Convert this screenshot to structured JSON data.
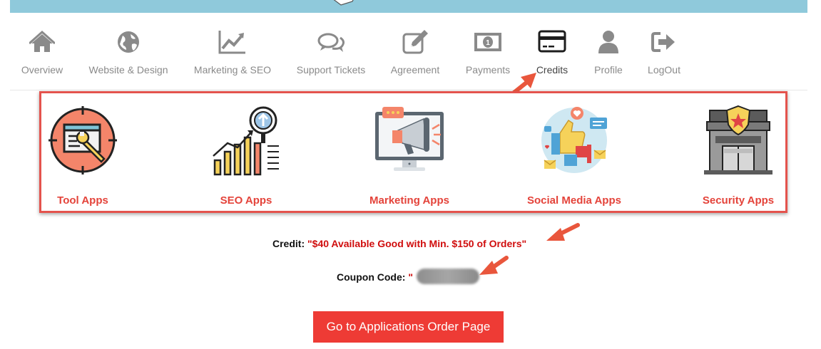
{
  "nav": {
    "items": [
      {
        "label": "Overview",
        "icon": "home-icon"
      },
      {
        "label": "Website & Design",
        "icon": "globe-icon"
      },
      {
        "label": "Marketing & SEO",
        "icon": "line-chart-icon"
      },
      {
        "label": "Support Tickets",
        "icon": "chat-bubbles-icon"
      },
      {
        "label": "Agreement",
        "icon": "edit-document-icon"
      },
      {
        "label": "Payments",
        "icon": "banknote-icon"
      },
      {
        "label": "Credits",
        "icon": "credit-card-icon",
        "active": true
      },
      {
        "label": "Profile",
        "icon": "user-icon"
      },
      {
        "label": "LogOut",
        "icon": "logout-icon"
      }
    ]
  },
  "apps": [
    {
      "label": "Tool Apps",
      "icon": "tool-apps-icon"
    },
    {
      "label": "SEO Apps",
      "icon": "seo-chart-magnifier-icon"
    },
    {
      "label": "Marketing Apps",
      "icon": "monitor-megaphone-icon"
    },
    {
      "label": "Social Media Apps",
      "icon": "social-media-thumbs-up-icon"
    },
    {
      "label": "Security Apps",
      "icon": "secure-store-badge-icon"
    }
  ],
  "credit": {
    "label": "Credit:",
    "value": "\"$40 Available Good with Min. $150 of Orders\""
  },
  "coupon": {
    "label": "Coupon Code:",
    "quote": "\""
  },
  "order_button": {
    "label": "Go to Applications Order Page"
  },
  "colors": {
    "accent_red": "#ee3b35",
    "label_red": "#e4433a",
    "credit_red": "#d00d0d",
    "banner_blue": "#8fc9db",
    "icon_gray": "#8a8a8a"
  }
}
